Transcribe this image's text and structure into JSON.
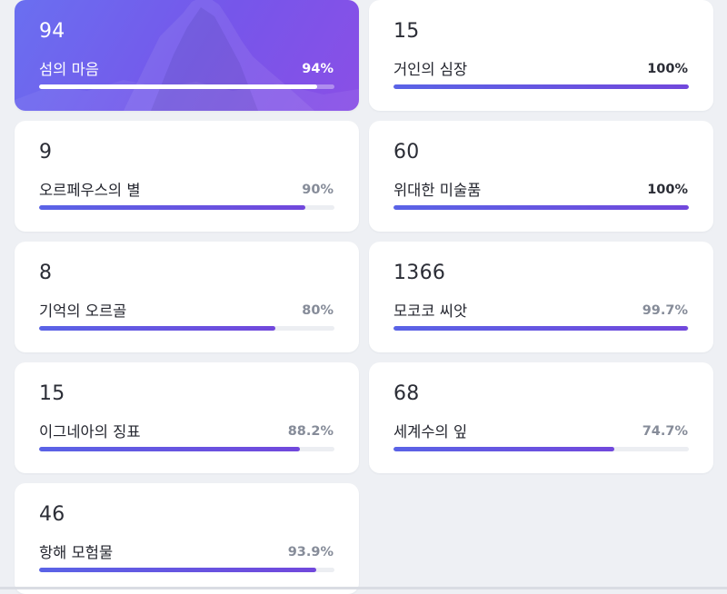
{
  "cards": [
    {
      "count": "94",
      "name": "섬의 마음",
      "percent": "94%",
      "progress": 0.94
    },
    {
      "count": "15",
      "name": "거인의 심장",
      "percent": "100%",
      "progress": 1.0
    },
    {
      "count": "9",
      "name": "오르페우스의 별",
      "percent": "90%",
      "progress": 0.9
    },
    {
      "count": "60",
      "name": "위대한 미술품",
      "percent": "100%",
      "progress": 1.0
    },
    {
      "count": "8",
      "name": "기억의 오르골",
      "percent": "80%",
      "progress": 0.8
    },
    {
      "count": "1366",
      "name": "모코코 씨앗",
      "percent": "99.7%",
      "progress": 0.997
    },
    {
      "count": "15",
      "name": "이그네아의 징표",
      "percent": "88.2%",
      "progress": 0.882
    },
    {
      "count": "68",
      "name": "세계수의 잎",
      "percent": "74.7%",
      "progress": 0.747
    },
    {
      "count": "46",
      "name": "항해 모험물",
      "percent": "93.9%",
      "progress": 0.939
    }
  ],
  "colors": {
    "accent_start": "#5a63e6",
    "accent_end": "#7148dc",
    "featured_bg": "#7656ea",
    "page_bg": "#eef0f4",
    "muted_text": "#868c99"
  },
  "featured_index": 0
}
